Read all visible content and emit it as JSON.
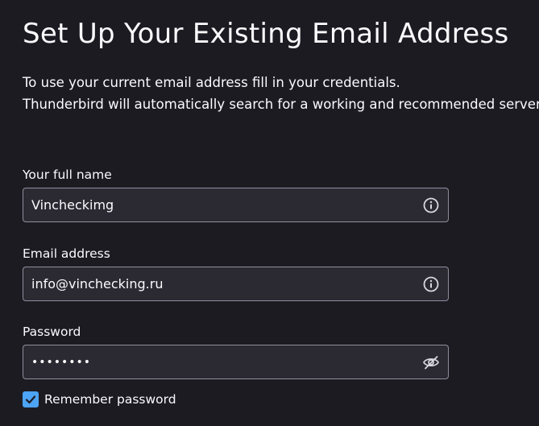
{
  "header": {
    "title": "Set Up Your Existing Email Address",
    "description_line1": "To use your current email address fill in your credentials.",
    "description_line2": "Thunderbird will automatically search for a working and recommended server configuration."
  },
  "form": {
    "name": {
      "label": "Your full name",
      "value": "Vincheckimg",
      "icon": "info-icon"
    },
    "email": {
      "label": "Email address",
      "value": "info@vinchecking.ru",
      "icon": "info-icon"
    },
    "password": {
      "label": "Password",
      "value": "••••••••",
      "icon": "eye-slash-icon"
    },
    "remember": {
      "label": "Remember password",
      "checked": true
    }
  },
  "colors": {
    "background": "#1c1b22",
    "field_background": "#2b2a33",
    "field_border": "#8f8f9d",
    "accent": "#4da3f5",
    "text": "#fbfbfe"
  }
}
